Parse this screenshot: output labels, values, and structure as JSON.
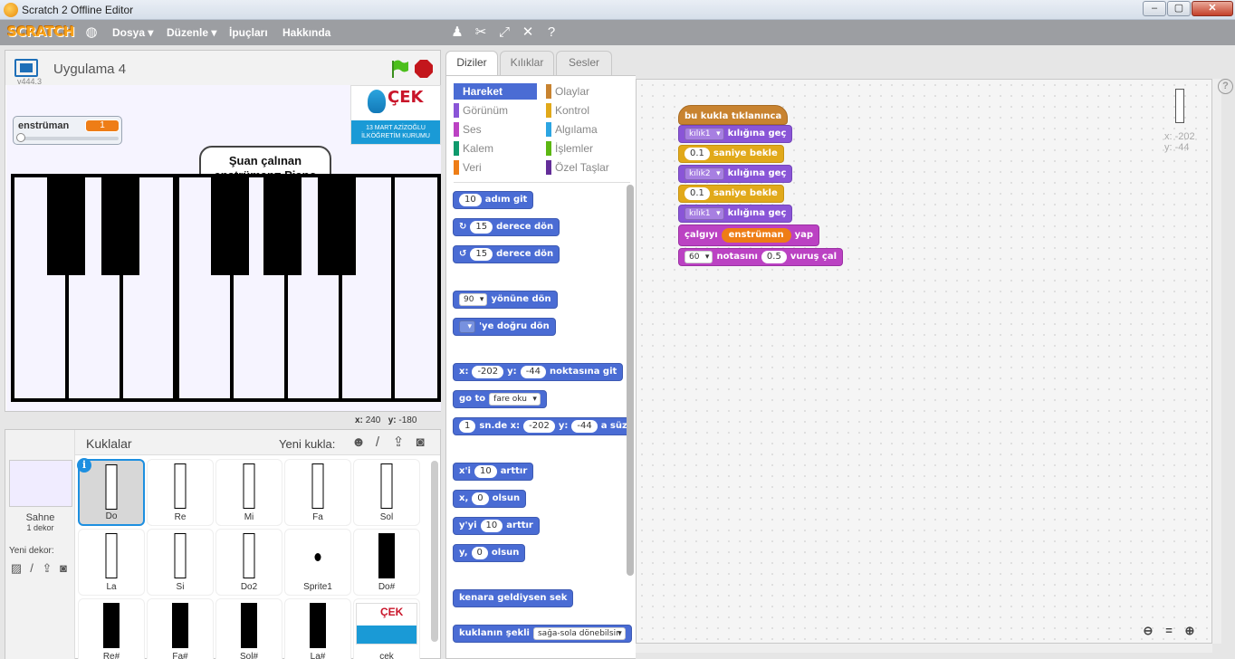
{
  "window": {
    "title": "Scratch 2 Offline Editor",
    "min": "–",
    "max": "▢",
    "close": "✕"
  },
  "menubar": {
    "logo": "SCRATCH",
    "items": [
      "Dosya ▾",
      "Düzenle ▾",
      "İpuçları",
      "Hakkında"
    ]
  },
  "stage": {
    "project_title": "Uygulama 4",
    "version": "v444.3",
    "variable_monitor": {
      "name": "enstrüman",
      "value": "1"
    },
    "speech_bubble": {
      "line1": "Şuan çalınan",
      "line2": "enstrüman= Piano"
    },
    "logo_text": "ÇEK",
    "logo_band": "13 MART AZİZOĞLU İLKÖĞRETİM KURUMU",
    "mouse_x_label": "x:",
    "mouse_x": "240",
    "mouse_y_label": "y:",
    "mouse_y": "-180"
  },
  "sprites": {
    "header": "Kuklalar",
    "new_sprite_label": "Yeni kukla:",
    "stage_label": "Sahne",
    "stage_backdrops": "1 dekor",
    "new_backdrop_label": "Yeni dekor:",
    "items": [
      {
        "name": "Do"
      },
      {
        "name": "Re"
      },
      {
        "name": "Mi"
      },
      {
        "name": "Fa"
      },
      {
        "name": "Sol"
      },
      {
        "name": "La"
      },
      {
        "name": "Si"
      },
      {
        "name": "Do2"
      },
      {
        "name": "Sprite1"
      },
      {
        "name": "Do#"
      },
      {
        "name": "Re#"
      },
      {
        "name": "Fa#"
      },
      {
        "name": "Sol#"
      },
      {
        "name": "La#"
      },
      {
        "name": "cek"
      }
    ]
  },
  "tabs": [
    "Diziler",
    "Kılıklar",
    "Sesler"
  ],
  "palette": {
    "categories_left": [
      "Hareket",
      "Görünüm",
      "Ses",
      "Kalem",
      "Veri"
    ],
    "categories_right": [
      "Olaylar",
      "Kontrol",
      "Algılama",
      "İşlemler",
      "Özel Taşlar"
    ],
    "blocks": {
      "move_steps": "10",
      "move_label": "adım git",
      "turn_right_deg": "15",
      "turn_label": "derece dön",
      "turn_left_deg": "15",
      "point_dir": "90",
      "point_label": "yönüne dön",
      "point_towards_label": "'ye doğru dön",
      "goto_x_label": "x:",
      "goto_x": "-202",
      "goto_y_label": "y:",
      "goto_y": "-44",
      "goto_xy_label": "noktasına git",
      "goto_label": "go to",
      "goto_target": "fare oku",
      "glide_secs": "1",
      "glide_label1": "sn.de x:",
      "glide_x": "-202",
      "glide_y_label": "y:",
      "glide_y": "-44",
      "glide_label2": "a süz",
      "change_x_label1": "x'i",
      "change_x": "10",
      "change_x_label2": "arttır",
      "set_x_label1": "x,",
      "set_x": "0",
      "set_x_label2": "olsun",
      "change_y_label1": "y'yi",
      "change_y": "10",
      "change_y_label2": "arttır",
      "set_y_label1": "y,",
      "set_y": "0",
      "set_y_label2": "olsun",
      "bounce_label": "kenara geldiysen sek",
      "rotation_label": "kuklanın şekli",
      "rotation_style": "sağa-sola dönebilsin"
    }
  },
  "script": {
    "hat": "bu kukla tıklanınca",
    "switch1_costume": "kılık1",
    "switch_label": "kılığına geç",
    "wait1": "0.1",
    "wait_label": "saniye bekle",
    "switch2_costume": "kılık2",
    "wait2": "0.1",
    "switch3_costume": "kılık1",
    "set_instrument_label1": "çalgıyı",
    "set_instrument_var": "enstrüman",
    "set_instrument_label2": "yap",
    "note": "60",
    "note_label": "notasını",
    "beats": "0.5",
    "beats_label": "vuruş çal"
  },
  "sprite_info": {
    "x_label": "x:",
    "x": "-202",
    "y_label": "y:",
    "y": "-44"
  },
  "icons": {
    "globe": "globe-icon",
    "duplicate": "duplicate-icon",
    "cut": "cut-icon",
    "grow": "grow-icon",
    "shrink": "shrink-icon",
    "help": "help-icon"
  },
  "colors": {
    "motion": "#4a6cd4",
    "looks": "#8a55d7",
    "sound": "#bb42c3",
    "pen": "#0e9a6c",
    "data": "#ee7d16",
    "events": "#c88330",
    "control": "#e1a91a",
    "sensing": "#2ca5e2",
    "operators": "#5cb712",
    "more": "#632d99"
  }
}
